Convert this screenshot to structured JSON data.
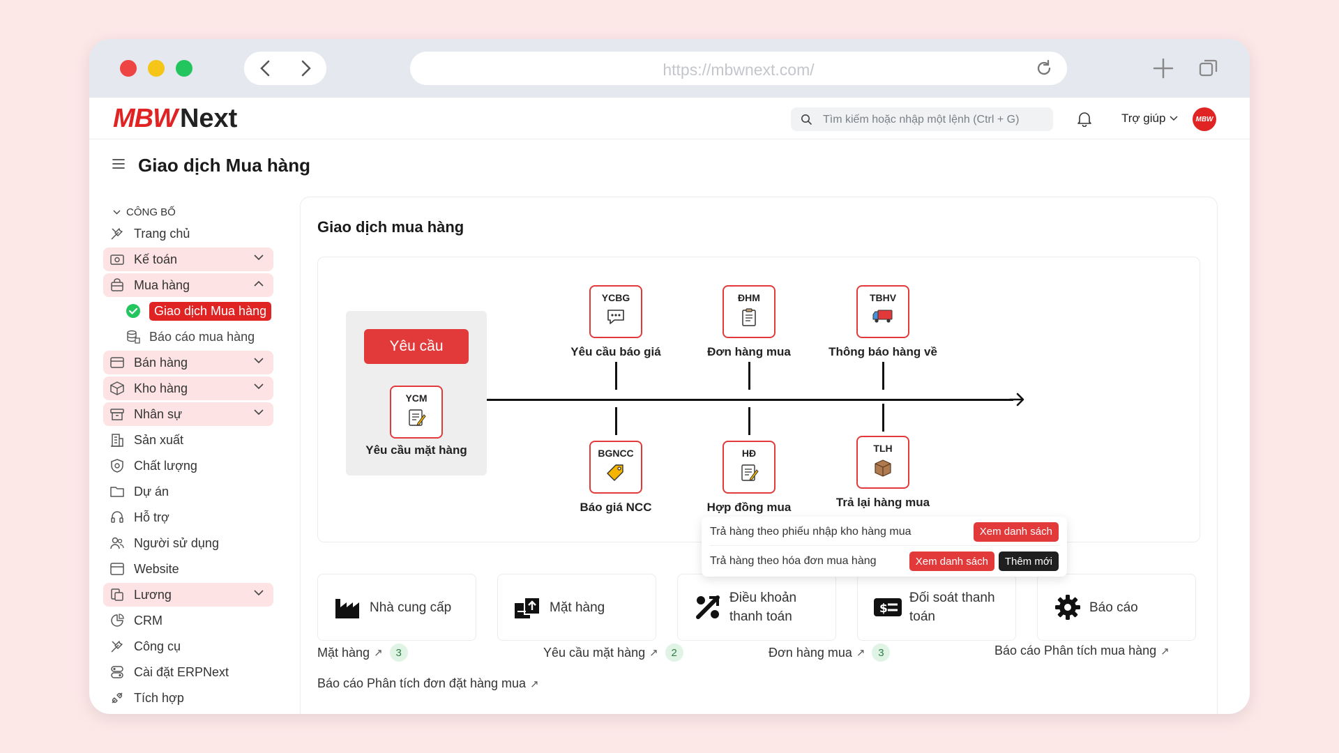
{
  "browser": {
    "url": "https://mbwnext.com/",
    "icons": [
      "back-arrow-icon",
      "forward-arrow-icon",
      "reload-icon",
      "plus-icon",
      "tabs-icon"
    ]
  },
  "topbar": {
    "logo_mark": "MBW",
    "logo_text": "Next",
    "search_placeholder": "Tìm kiếm hoặc nhập một lệnh (Ctrl + G)",
    "help_label": "Trợ giúp",
    "avatar_text": "MBW"
  },
  "page": {
    "title": "Giao dịch Mua hàng"
  },
  "sidebar": {
    "section_label": "CÔNG BỐ",
    "items": [
      {
        "label": "Trang chủ",
        "icon": "tools-icon"
      },
      {
        "label": "Kế toán",
        "icon": "accounting-icon"
      },
      {
        "label": "Mua hàng",
        "icon": "shopping-bag-icon"
      },
      {
        "label": "Giao dịch Mua hàng",
        "icon": "check-circle-icon"
      },
      {
        "label": "Báo cáo mua hàng",
        "icon": "database-icon"
      },
      {
        "label": "Bán hàng",
        "icon": "sales-icon"
      },
      {
        "label": "Kho hàng",
        "icon": "box-icon"
      },
      {
        "label": "Nhân sự",
        "icon": "hr-icon"
      },
      {
        "label": "Sản xuất",
        "icon": "building-icon"
      },
      {
        "label": "Chất lượng",
        "icon": "shield-icon"
      },
      {
        "label": "Dự án",
        "icon": "folder-icon"
      },
      {
        "label": "Hỗ trợ",
        "icon": "headset-icon"
      },
      {
        "label": "Người sử dụng",
        "icon": "users-icon"
      },
      {
        "label": "Website",
        "icon": "browser-icon"
      },
      {
        "label": "Lương",
        "icon": "payroll-icon"
      },
      {
        "label": "CRM",
        "icon": "crm-icon"
      },
      {
        "label": "Công cụ",
        "icon": "tools-icon"
      },
      {
        "label": "Cài đặt ERPNext",
        "icon": "settings-icon"
      },
      {
        "label": "Tích hợp",
        "icon": "integration-icon"
      }
    ]
  },
  "panel": {
    "title": "Giao dịch mua hàng",
    "request_button": "Yêu cầu",
    "nodes": {
      "ycm": {
        "code": "YCM",
        "label": "Yêu cầu mặt hàng",
        "icon": "memo-icon"
      },
      "ycbg": {
        "code": "YCBG",
        "label": "Yêu cầu báo giá",
        "icon": "chat-icon"
      },
      "dhm": {
        "code": "ĐHM",
        "label": "Đơn hàng mua",
        "icon": "clipboard-icon"
      },
      "tbhv": {
        "code": "TBHV",
        "label": "Thông báo hàng về",
        "icon": "truck-icon"
      },
      "bgncc": {
        "code": "BGNCC",
        "label": "Báo giá NCC",
        "icon": "tag-icon"
      },
      "hd": {
        "code": "HĐ",
        "label": "Hợp đồng mua",
        "icon": "memo-icon"
      },
      "tlh": {
        "code": "TLH",
        "label": "Trả lại hàng mua",
        "icon": "package-icon"
      }
    },
    "popup": {
      "row1": "Trả hàng theo phiếu nhập kho hàng mua",
      "row2": "Trả hàng theo hóa đơn mua hàng",
      "view_list": "Xem danh sách",
      "add_new": "Thêm mới"
    },
    "cards": [
      {
        "label": "Nhà cung cấp",
        "icon": "factory-icon"
      },
      {
        "label": "Mặt hàng",
        "icon": "items-icon"
      },
      {
        "label": "Điều khoản thanh toán",
        "icon": "percent-icon"
      },
      {
        "label": "Đối soát thanh toán",
        "icon": "money-icon"
      },
      {
        "label": "Báo cáo",
        "icon": "gear-icon"
      }
    ],
    "links": [
      {
        "label": "Mặt hàng",
        "count": "3"
      },
      {
        "label": "Yêu cầu mặt hàng",
        "count": "2"
      },
      {
        "label": "Đơn hàng mua",
        "count": "3"
      },
      {
        "label": "Báo cáo Phân tích mua hàng"
      },
      {
        "label": "Báo cáo Phân tích đơn đặt hàng mua"
      }
    ]
  },
  "colors": {
    "accent": "#e23a3a",
    "active_green": "#22c55e",
    "group_bg": "#fde3e3"
  }
}
